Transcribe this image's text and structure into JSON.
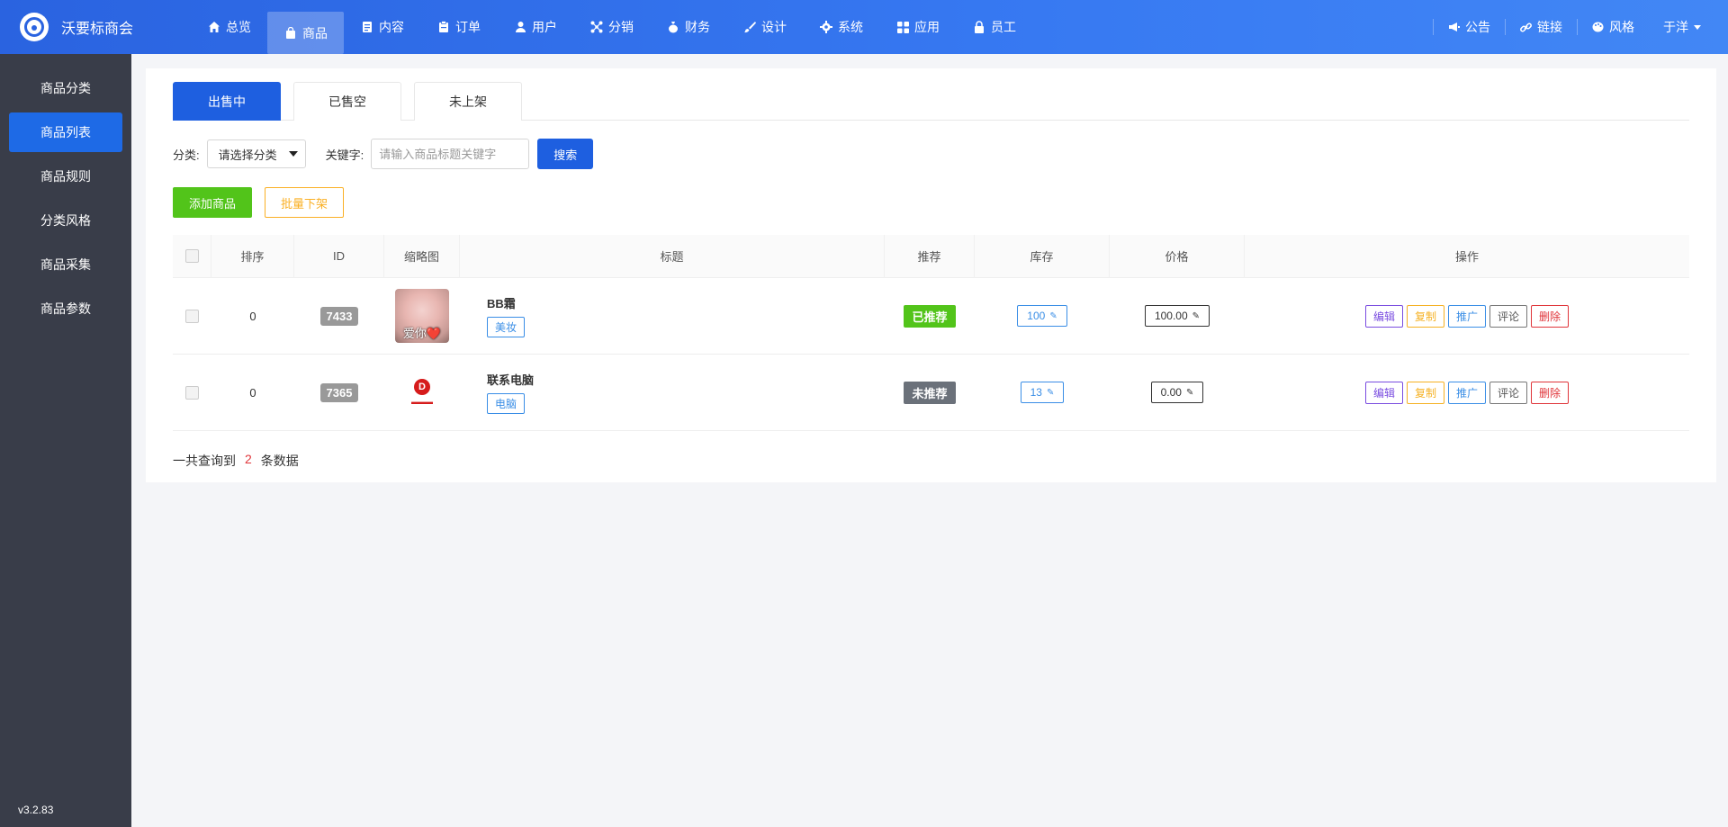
{
  "brand": {
    "name": "沃要标商会"
  },
  "nav": [
    {
      "label": "总览",
      "icon": "home-icon"
    },
    {
      "label": "商品",
      "icon": "bag-icon",
      "active": true
    },
    {
      "label": "内容",
      "icon": "document-icon"
    },
    {
      "label": "订单",
      "icon": "clipboard-icon"
    },
    {
      "label": "用户",
      "icon": "user-icon"
    },
    {
      "label": "分销",
      "icon": "network-icon"
    },
    {
      "label": "财务",
      "icon": "money-bag-icon"
    },
    {
      "label": "设计",
      "icon": "brush-icon"
    },
    {
      "label": "系统",
      "icon": "gear-icon"
    },
    {
      "label": "应用",
      "icon": "grid-icon"
    },
    {
      "label": "员工",
      "icon": "lock-icon"
    }
  ],
  "right_menu": {
    "notice": "公告",
    "link": "链接",
    "style": "风格",
    "user": "于洋"
  },
  "sidebar": {
    "items": [
      {
        "label": "商品分类"
      },
      {
        "label": "商品列表",
        "active": true
      },
      {
        "label": "商品规则"
      },
      {
        "label": "分类风格"
      },
      {
        "label": "商品采集"
      },
      {
        "label": "商品参数"
      }
    ],
    "version": "v3.2.83"
  },
  "tabs": [
    {
      "label": "出售中",
      "active": true
    },
    {
      "label": "已售空"
    },
    {
      "label": "未上架"
    }
  ],
  "filter": {
    "category_label": "分类:",
    "category_value": "请选择分类",
    "keyword_label": "关键字:",
    "keyword_placeholder": "请输入商品标题关键字",
    "search_label": "搜索"
  },
  "actions": {
    "add": "添加商品",
    "batch_off": "批量下架"
  },
  "table": {
    "headers": {
      "sort": "排序",
      "id": "ID",
      "thumb": "缩略图",
      "title": "标题",
      "recommend": "推荐",
      "stock": "库存",
      "price": "价格",
      "ops": "操作"
    },
    "rows": [
      {
        "sort": "0",
        "id": "7433",
        "thumb_text": "爱你❤️",
        "title": "BB霜",
        "category": "美妆",
        "recommend": "已推荐",
        "recommended": true,
        "stock": "100",
        "price": "100.00"
      },
      {
        "sort": "0",
        "id": "7365",
        "thumb_text": "",
        "title": "联系电脑",
        "category": "电脑",
        "recommend": "未推荐",
        "recommended": false,
        "stock": "13",
        "price": "0.00"
      }
    ],
    "ops": {
      "edit": "编辑",
      "copy": "复制",
      "promote": "推广",
      "comment": "评论",
      "delete": "删除"
    }
  },
  "summary": {
    "prefix": "一共查询到",
    "count": "2",
    "suffix": "条数据"
  },
  "colors": {
    "primary": "#1e5fe0",
    "sidebar": "#393d49",
    "success": "#52c41a",
    "warning": "#fab025",
    "danger": "#e0353a"
  }
}
